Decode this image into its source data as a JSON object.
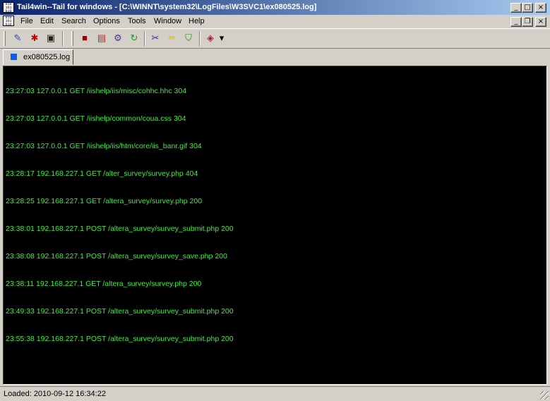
{
  "window": {
    "title": "Tail4win--Tail for windows - [C:\\WINNT\\system32\\LogFiles\\W3SVC1\\ex080525.log]",
    "app_icon_text": "010\n101\n010",
    "controls": {
      "minimize": "_",
      "maximize": "□",
      "close": "×",
      "restore": "❐"
    }
  },
  "menu": {
    "items": [
      "File",
      "Edit",
      "Search",
      "Options",
      "Tools",
      "Window",
      "Help"
    ]
  },
  "toolbar": {
    "buttons": [
      {
        "icon": "open-file-icon",
        "glyph": "✎",
        "color": "#2a4fc0"
      },
      {
        "icon": "bug-icon",
        "glyph": "✱",
        "color": "#c00000"
      },
      {
        "icon": "monitor-icon",
        "glyph": "▣",
        "color": "#202020"
      },
      {
        "icon": "stop-icon",
        "glyph": "■",
        "color": "#a00000"
      },
      {
        "icon": "pdf-icon",
        "glyph": "▤",
        "color": "#d02020"
      },
      {
        "icon": "settings-icon",
        "glyph": "⚙",
        "color": "#404080"
      },
      {
        "icon": "refresh-icon",
        "glyph": "↻",
        "color": "#1a9a1a"
      },
      {
        "icon": "tools-icon",
        "glyph": "✂",
        "color": "#303090"
      },
      {
        "icon": "highlight-icon",
        "glyph": "✏",
        "color": "#e0c000"
      },
      {
        "icon": "filter-icon",
        "glyph": "⛉",
        "color": "#208020"
      },
      {
        "icon": "layout-icon",
        "glyph": "◈",
        "color": "#a02040"
      },
      {
        "icon": "dropdown-arrow-icon",
        "glyph": "▾",
        "color": "#000000"
      }
    ]
  },
  "tabs": [
    {
      "label": "ex080525.log",
      "active": true
    }
  ],
  "log": {
    "text_color": "#3cf03c",
    "lines": [
      "23:27:03 127.0.0.1 GET /iishelp/iis/misc/cohhc.hhc 304",
      "23:27:03 127.0.0.1 GET /iishelp/common/coua.css 304",
      "23:27:03 127.0.0.1 GET /iishelp/iis/htm/core/iis_banr.gif 304",
      "23:28:17 192.168.227.1 GET /alter_survey/survey.php 404",
      "23:28:25 192.168.227.1 GET /altera_survey/survey.php 200",
      "23:38:01 192.168.227.1 POST /altera_survey/survey_submit.php 200",
      "23:38:08 192.168.227.1 POST /altera_survey/survey_save.php 200",
      "23:38:11 192.168.227.1 GET /altera_survey/survey.php 200",
      "23:49:33 192.168.227.1 POST /altera_survey/survey_submit.php 200",
      "23:55:38 192.168.227.1 POST /altera_survey/survey_submit.php 200"
    ]
  },
  "status": {
    "text": "Loaded:  2010-09-12 16:34:22"
  }
}
